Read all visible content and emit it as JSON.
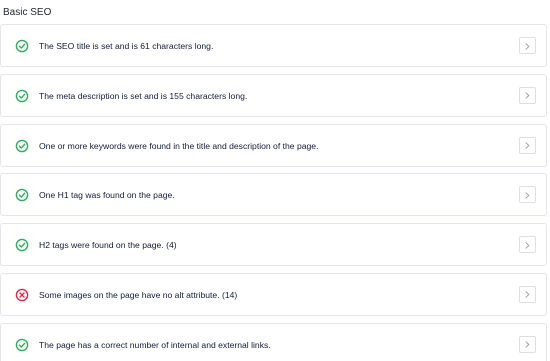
{
  "section": {
    "title": "Basic SEO"
  },
  "colors": {
    "pass": "#2bb05b",
    "fail": "#df2a4a",
    "text": "#141b38",
    "border": "#e4e6eb"
  },
  "checks": [
    {
      "status": "pass",
      "icon": "check-circle-icon",
      "message": "The SEO title is set and is 61 characters long."
    },
    {
      "status": "pass",
      "icon": "check-circle-icon",
      "message": "The meta description is set and is 155 characters long."
    },
    {
      "status": "pass",
      "icon": "check-circle-icon",
      "message": "One or more keywords were found in the title and description of the page."
    },
    {
      "status": "pass",
      "icon": "check-circle-icon",
      "message": "One H1 tag was found on the page."
    },
    {
      "status": "pass",
      "icon": "check-circle-icon",
      "message": "H2 tags were found on the page. (4)"
    },
    {
      "status": "fail",
      "icon": "error-circle-icon",
      "message": "Some images on the page have no alt attribute. (14)"
    },
    {
      "status": "pass",
      "icon": "check-circle-icon",
      "message": "The page has a correct number of internal and external links."
    }
  ]
}
